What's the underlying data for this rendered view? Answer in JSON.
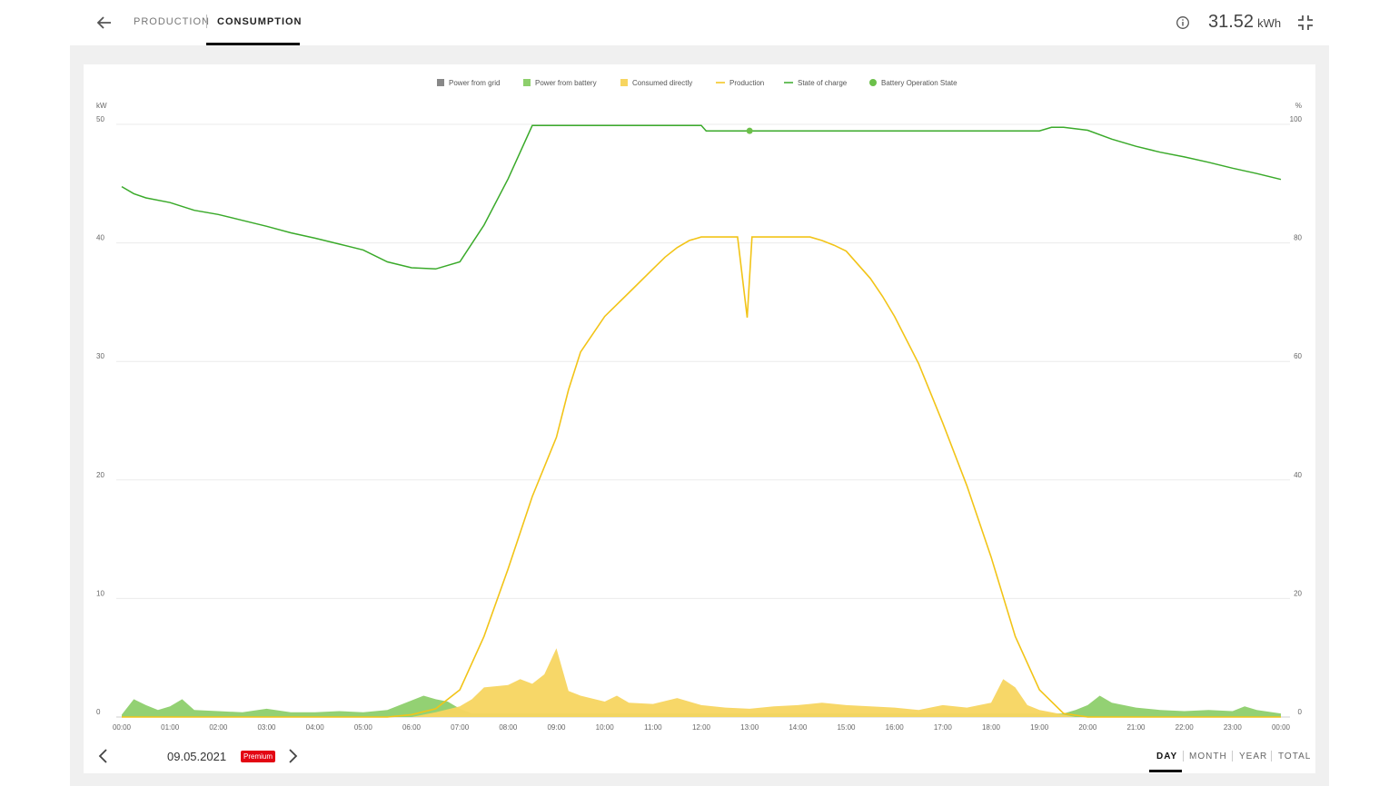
{
  "header": {
    "tabs": [
      {
        "label": "PRODUCTION"
      },
      {
        "label": "CONSUMPTION"
      }
    ],
    "active_tab": 1,
    "energy_value": "31.52",
    "energy_unit": "kWh"
  },
  "footer": {
    "date": "09.05.2021",
    "badge": "Premium",
    "periods": [
      "DAY",
      "MONTH",
      "YEAR",
      "TOTAL"
    ],
    "active_period": "DAY"
  },
  "colors": {
    "grid": "#888888",
    "battery": "#8dcf6c",
    "consumed": "#f7d560",
    "production": "#f2c418",
    "soc": "#3aaa2a",
    "badge": "#e30613"
  },
  "chart_data": {
    "type": "area",
    "legend": {
      "position": "top-center",
      "items": [
        {
          "label": "Power from grid",
          "symbol": "square",
          "color": "#888888"
        },
        {
          "label": "Power from battery",
          "symbol": "square",
          "color": "#8dcf6c"
        },
        {
          "label": "Consumed directly",
          "symbol": "square",
          "color": "#f7d560"
        },
        {
          "label": "Production",
          "symbol": "line",
          "color": "#f2c418"
        },
        {
          "label": "State of charge",
          "symbol": "line",
          "color": "#3aaa2a"
        },
        {
          "label": "Battery Operation State",
          "symbol": "circle",
          "color": "#6cc04a"
        }
      ]
    },
    "ylabel_left": "kW",
    "ylabel_right": "%",
    "ylim_left": [
      0,
      50
    ],
    "ylim_right": [
      0,
      100
    ],
    "yticks_left": [
      "0",
      "10",
      "20",
      "30",
      "40",
      "50"
    ],
    "yticks_right": [
      "0",
      "20",
      "40",
      "60",
      "80",
      "100"
    ],
    "xlim_hours": [
      0,
      24
    ],
    "xticks": [
      "00:00",
      "01:00",
      "02:00",
      "03:00",
      "04:00",
      "05:00",
      "06:00",
      "07:00",
      "08:00",
      "09:00",
      "10:00",
      "11:00",
      "12:00",
      "13:00",
      "14:00",
      "15:00",
      "16:00",
      "17:00",
      "18:00",
      "19:00",
      "20:00",
      "21:00",
      "22:00",
      "23:00",
      "00:00"
    ],
    "grid": true,
    "series": [
      {
        "name": "State of charge",
        "type": "line",
        "axis": "right",
        "x": [
          0,
          0.25,
          0.5,
          1,
          1.5,
          2,
          2.5,
          3,
          3.5,
          4,
          4.5,
          5,
          5.5,
          6,
          6.5,
          7,
          7.5,
          8,
          8.5,
          9,
          9.5,
          10,
          11,
          12,
          12.1,
          13,
          14,
          15,
          16,
          17,
          18,
          19,
          19.25,
          19.5,
          20,
          20.5,
          21,
          21.5,
          22,
          22.5,
          23,
          23.5,
          24
        ],
        "y": [
          89.5,
          88.3,
          87.6,
          86.8,
          85.5,
          84.8,
          83.8,
          82.8,
          81.7,
          80.8,
          79.8,
          78.8,
          76.8,
          75.8,
          75.6,
          76.8,
          83,
          90.8,
          99.8,
          99.8,
          99.8,
          99.8,
          99.8,
          99.8,
          98.9,
          98.9,
          98.9,
          98.9,
          98.9,
          98.9,
          98.9,
          98.9,
          99.5,
          99.5,
          99,
          97.5,
          96.3,
          95.3,
          94.5,
          93.6,
          92.6,
          91.7,
          90.7
        ]
      },
      {
        "name": "Production",
        "type": "line",
        "axis": "left",
        "x": [
          0,
          5.5,
          6,
          6.5,
          7,
          7.5,
          8,
          8.5,
          9,
          9.25,
          9.5,
          10,
          10.5,
          11,
          11.25,
          11.5,
          11.75,
          12,
          12.5,
          12.75,
          12.95,
          13.05,
          13.25,
          13.5,
          14,
          14.25,
          14.5,
          14.75,
          15,
          15.5,
          15.75,
          16,
          16.5,
          17,
          17.5,
          18,
          18.5,
          19,
          19.5,
          20,
          20.5,
          21,
          24
        ],
        "y": [
          0,
          0,
          0.2,
          0.7,
          2.3,
          6.8,
          12.5,
          18.6,
          23.6,
          27.6,
          30.8,
          33.8,
          35.8,
          37.8,
          38.8,
          39.6,
          40.2,
          40.5,
          40.5,
          40.5,
          33.7,
          40.5,
          40.5,
          40.5,
          40.5,
          40.5,
          40.2,
          39.8,
          39.3,
          37,
          35.5,
          33.8,
          29.8,
          24.8,
          19.5,
          13.5,
          6.8,
          2.3,
          0.3,
          0,
          0,
          0,
          0
        ]
      },
      {
        "name": "Consumed directly",
        "type": "area",
        "axis": "left",
        "x": [
          0,
          6,
          6.5,
          7,
          7.25,
          7.5,
          8,
          8.25,
          8.5,
          8.75,
          9,
          9.25,
          9.5,
          10,
          10.25,
          10.5,
          11,
          11.5,
          12,
          12.5,
          13,
          13.5,
          14,
          14.5,
          15,
          15.5,
          16,
          16.5,
          17,
          17.5,
          18,
          18.25,
          18.5,
          18.75,
          19,
          19.25,
          19.5,
          19.75,
          20,
          24
        ],
        "y": [
          0,
          0,
          0.4,
          0.9,
          1.5,
          2.5,
          2.7,
          3.2,
          2.8,
          3.6,
          5.8,
          2.2,
          1.8,
          1.3,
          1.8,
          1.2,
          1.1,
          1.6,
          1.0,
          0.8,
          0.7,
          0.9,
          1.0,
          1.2,
          1.0,
          0.9,
          0.8,
          0.6,
          1.0,
          0.8,
          1.2,
          3.2,
          2.5,
          1.0,
          0.6,
          0.4,
          0.2,
          0,
          0,
          0
        ]
      },
      {
        "name": "Power from battery",
        "type": "area",
        "axis": "left",
        "x": [
          0,
          0.25,
          0.5,
          0.75,
          1,
          1.25,
          1.5,
          2,
          2.5,
          3,
          3.5,
          4,
          4.5,
          5,
          5.5,
          6,
          6.25,
          6.5,
          6.75,
          7,
          7.25,
          19.5,
          19.75,
          20,
          20.25,
          20.5,
          21,
          21.5,
          22,
          22.5,
          23,
          23.25,
          23.5,
          24
        ],
        "y": [
          0.2,
          1.5,
          1.0,
          0.6,
          0.9,
          1.5,
          0.6,
          0.5,
          0.4,
          0.7,
          0.4,
          0.4,
          0.5,
          0.4,
          0.6,
          1.4,
          1.8,
          1.5,
          1.3,
          0.7,
          0.3,
          0.3,
          0.6,
          1.0,
          1.8,
          1.2,
          0.8,
          0.6,
          0.5,
          0.6,
          0.5,
          0.9,
          0.6,
          0.3
        ]
      },
      {
        "name": "Battery Operation State",
        "type": "point",
        "axis": "right",
        "x": [
          13
        ],
        "y": [
          98.9
        ]
      }
    ]
  }
}
